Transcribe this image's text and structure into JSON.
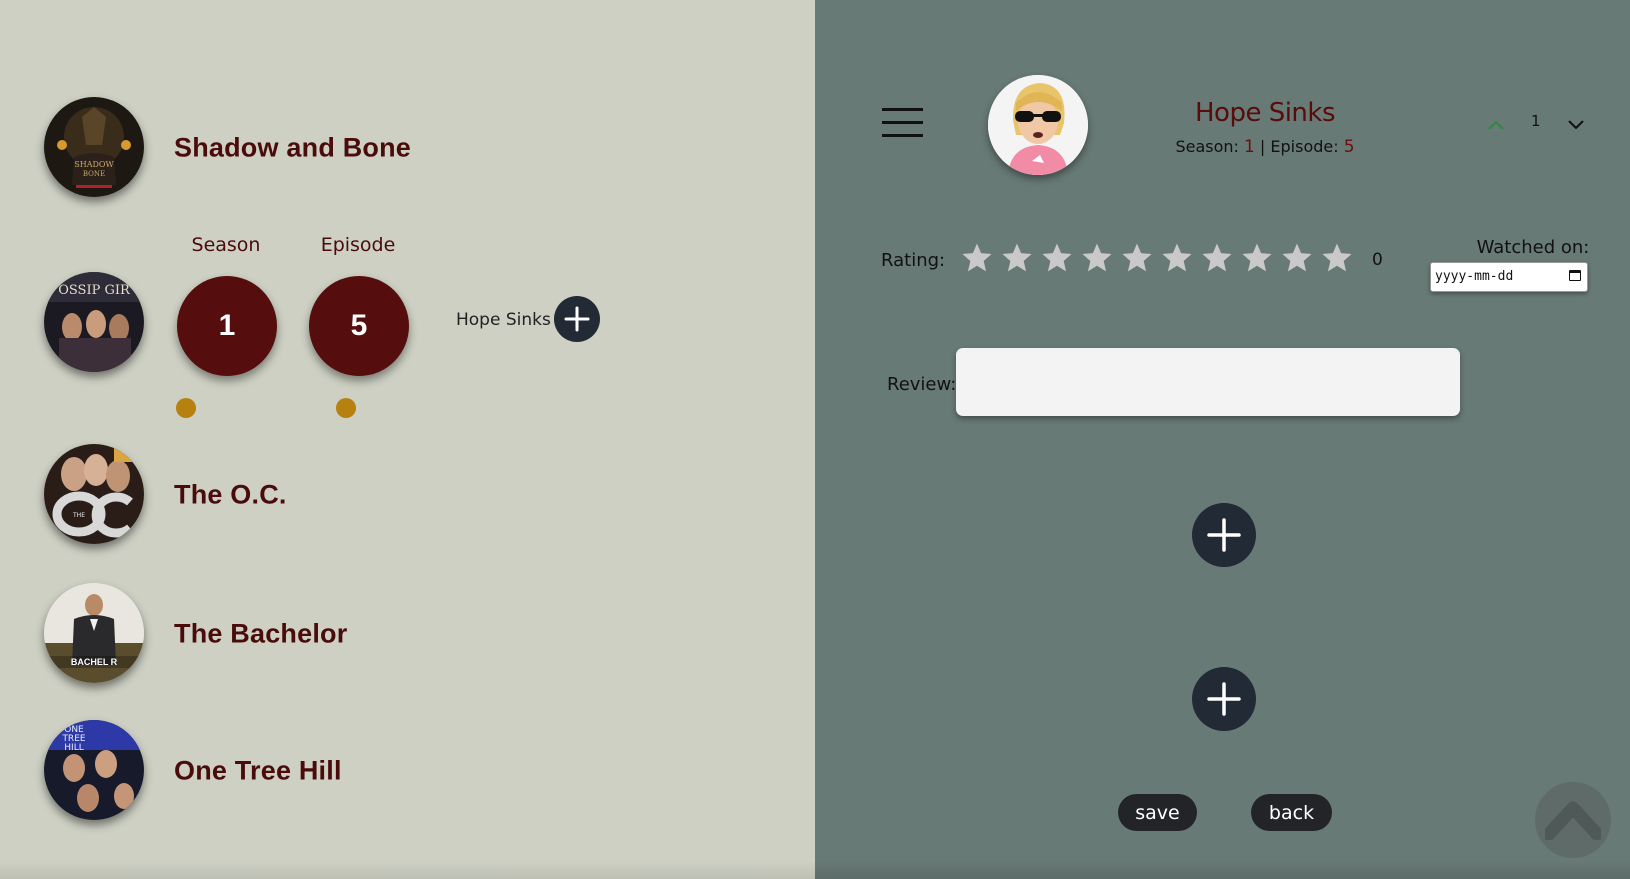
{
  "colors": {
    "left_bg": "#cdd0c3",
    "right_bg": "#687a76",
    "title_maroon": "#4a0b0b",
    "counter_maroon": "#560d0d",
    "knob_gold": "#b78110",
    "button_dark": "#222a36",
    "pill_dark": "#222427"
  },
  "shows": [
    {
      "title": "Shadow and Bone",
      "poster_icon": "shadow-and-bone-poster"
    },
    {
      "title": "Gossip Girl",
      "poster_icon": "gossip-girl-poster",
      "poster_text": "OSSIP GIR"
    },
    {
      "title": "The O.C.",
      "poster_icon": "the-oc-poster"
    },
    {
      "title": "The Bachelor",
      "poster_icon": "bachelor-poster",
      "poster_text": "BACHEL R"
    },
    {
      "title": "One Tree Hill",
      "poster_icon": "one-tree-hill-poster"
    }
  ],
  "counters": {
    "season_label": "Season",
    "season_value": "1",
    "episode_label": "Episode",
    "episode_value": "5",
    "episode_name": "Hope Sinks"
  },
  "detail": {
    "title": "Hope Sinks",
    "season_label": "Season:",
    "season": "1",
    "separator": "|",
    "episode_label": "Episode:",
    "episode": "5",
    "pager_value": "1",
    "rating_label": "Rating:",
    "rating_value": "0",
    "max_stars": 10,
    "watched_label": "Watched on:",
    "date_placeholder": "yyyy-mm-dd",
    "review_label": "Review:",
    "review_value": "",
    "save_label": "save",
    "back_label": "back"
  },
  "icons": [
    "menu-icon",
    "avatar-icon",
    "chevron-up-icon",
    "chevron-down-icon",
    "star-icon",
    "calendar-icon",
    "plus-icon",
    "scroll-top-icon"
  ]
}
